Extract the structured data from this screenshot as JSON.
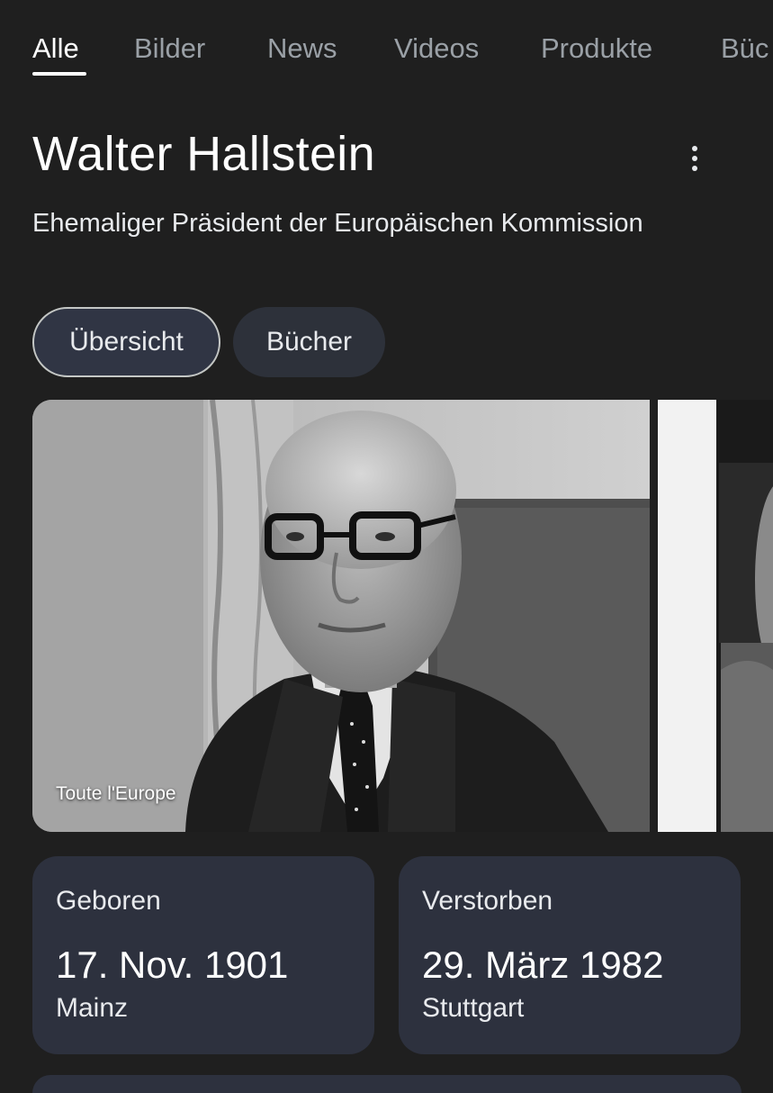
{
  "tabs": [
    {
      "label": "Alle",
      "active": true
    },
    {
      "label": "Bilder",
      "active": false
    },
    {
      "label": "News",
      "active": false
    },
    {
      "label": "Videos",
      "active": false
    },
    {
      "label": "Produkte",
      "active": false
    },
    {
      "label": "Büc",
      "active": false
    }
  ],
  "panel": {
    "title": "Walter Hallstein",
    "subtitle": "Ehemaliger Präsident der Europäischen Kommission",
    "more_icon": "more-vert-icon"
  },
  "chips": [
    {
      "label": "Übersicht",
      "selected": true
    },
    {
      "label": "Bücher",
      "selected": false
    }
  ],
  "images": {
    "main_caption": "Toute l'Europe"
  },
  "facts": [
    {
      "label": "Geboren",
      "date": "17. Nov. 1901",
      "place": "Mainz"
    },
    {
      "label": "Verstorben",
      "date": "29. März 1982",
      "place": "Stuttgart"
    }
  ],
  "colors": {
    "background": "#1f1f1f",
    "card": "#2d313e",
    "text": "#e8eaed",
    "tab_inactive": "#9aa0a6"
  }
}
